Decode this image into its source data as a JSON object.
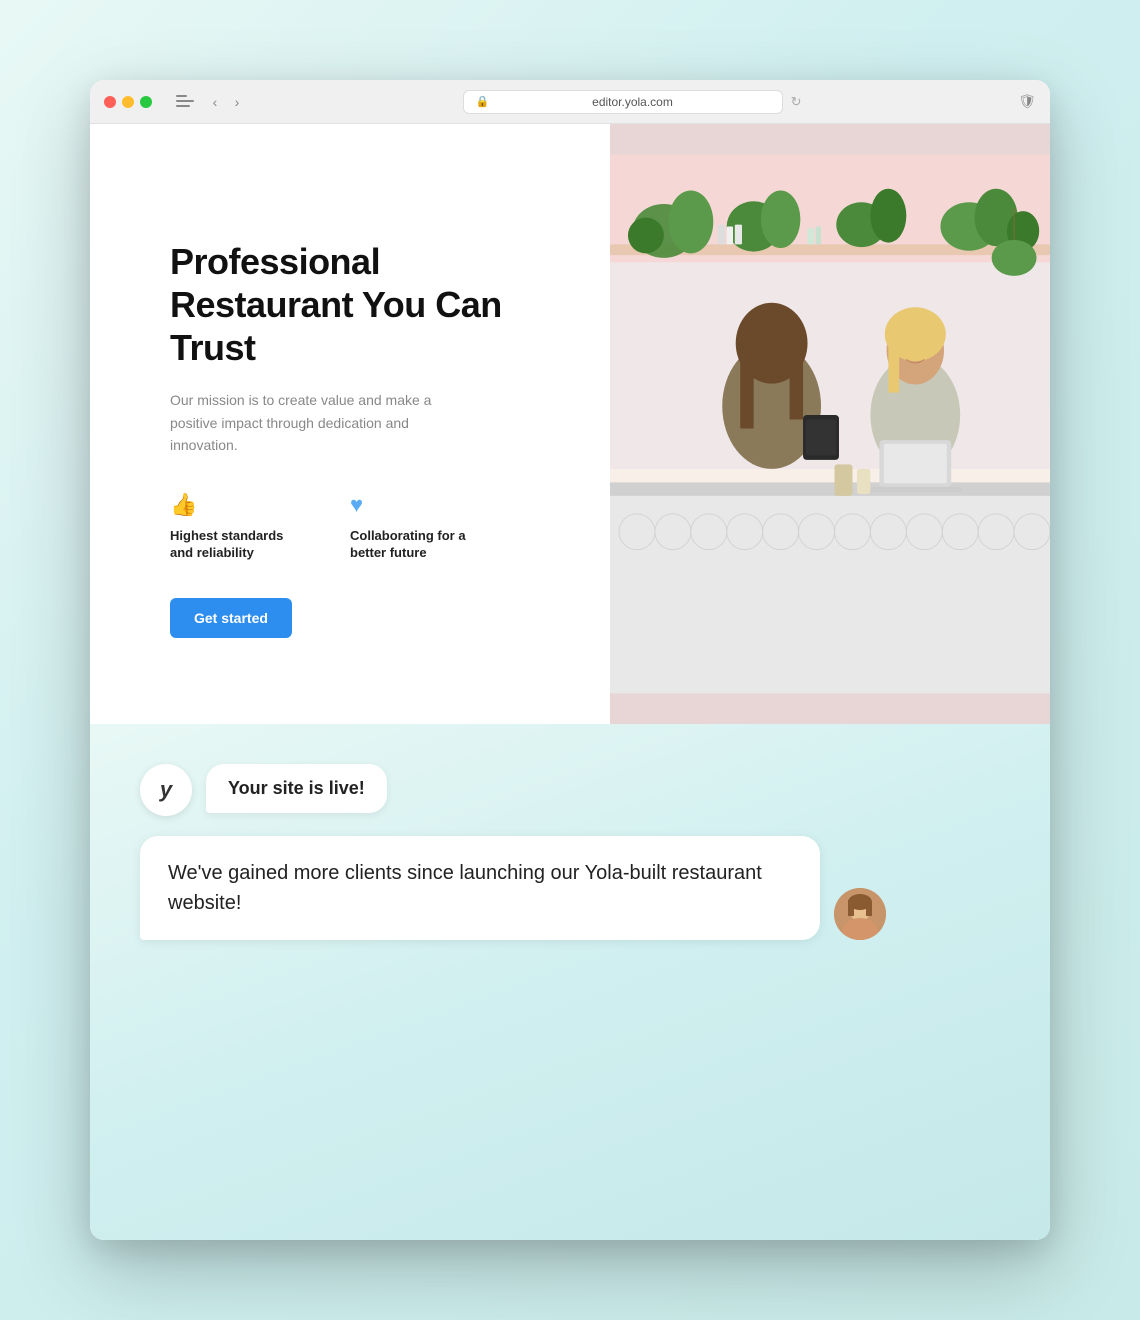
{
  "browser": {
    "url": "editor.yola.com",
    "traffic_lights": [
      "red",
      "yellow",
      "green"
    ]
  },
  "website": {
    "hero_title": "Professional Restaurant You Can Trust",
    "hero_subtitle": "Our mission is to create value and make a positive impact through dedication and innovation.",
    "features": [
      {
        "id": "standards",
        "icon": "👍",
        "label": "Highest standards and reliability"
      },
      {
        "id": "collaborating",
        "icon": "♥",
        "label": "Collaborating for a better future"
      }
    ],
    "cta_button": "Get started"
  },
  "chat": {
    "yola_letter": "y",
    "message_received": "Your site is live!",
    "message_sent": "We've gained more clients since launching our Yola-built restaurant website!"
  }
}
